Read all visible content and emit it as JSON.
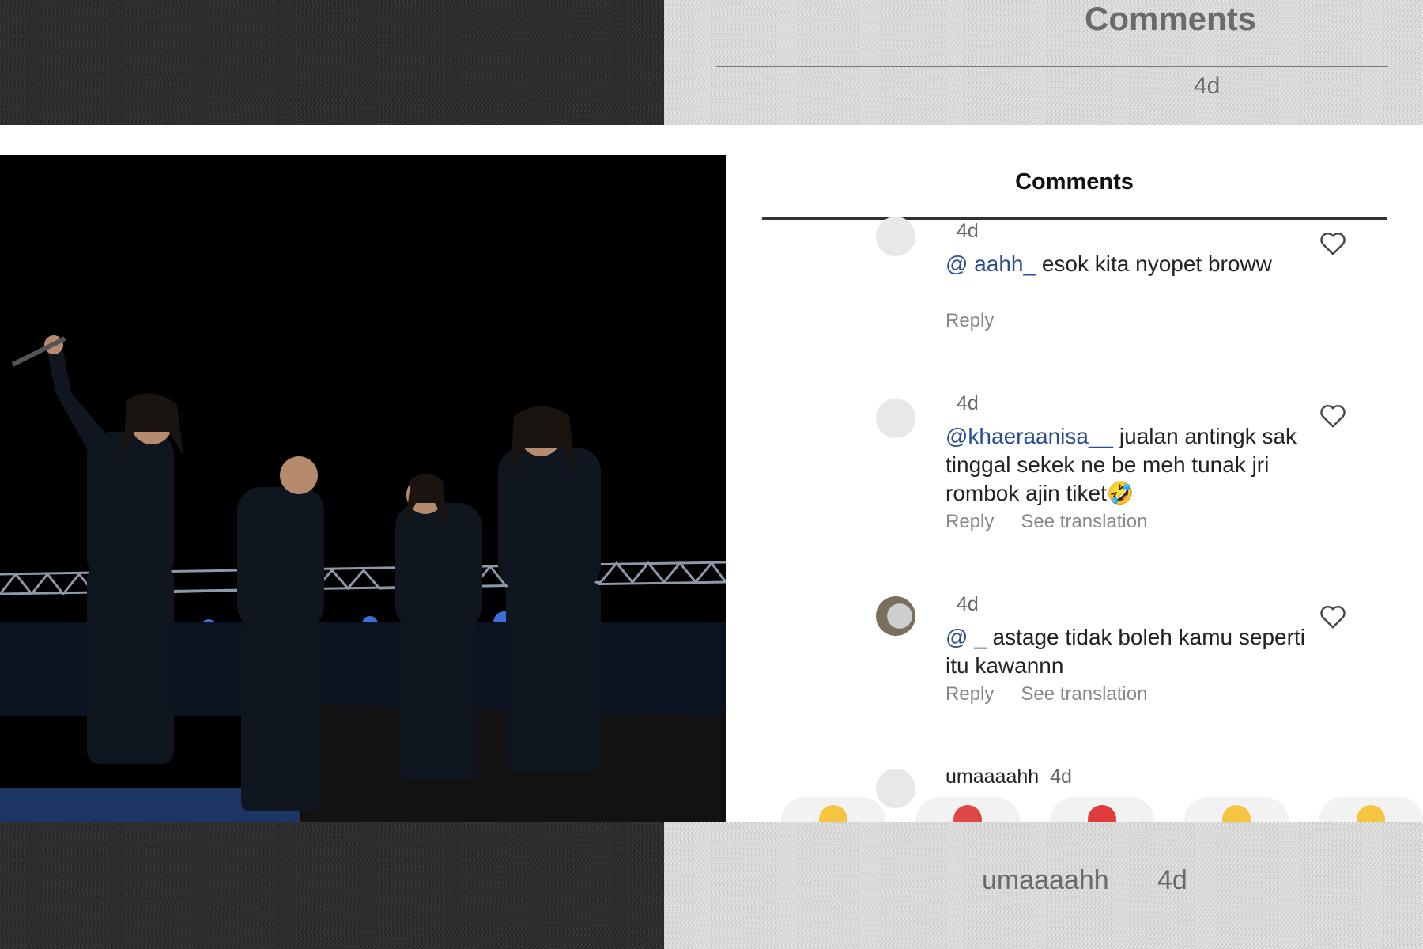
{
  "ghost_header": {
    "title": "Comments",
    "age": "4d"
  },
  "ghost_footer": {
    "username": "umaaaahh",
    "age": "4d"
  },
  "panel": {
    "title": "Comments"
  },
  "comments": [
    {
      "username": "",
      "age": "4d",
      "mention": "@         aahh_",
      "text": " esok kita nyopet broww",
      "reply": "Reply",
      "translate": ""
    },
    {
      "username": "",
      "age": "4d",
      "mention": "@khaeraanisa__",
      "text": " jualan antingk sak tinggal sekek ne be meh tunak jri rombok ajin tiket🤣",
      "reply": "Reply",
      "translate": "See translation"
    },
    {
      "username": "",
      "age": "4d",
      "mention": "@               _",
      "text": " astage tidak boleh kamu seperti itu kawannn",
      "reply": "Reply",
      "translate": "See translation"
    },
    {
      "username": "umaaaahh",
      "age": "4d",
      "mention": "",
      "text": "",
      "reply": "",
      "translate": ""
    }
  ],
  "icons": {
    "like": "heart-outline-icon"
  },
  "colors": {
    "mention": "#2a4e8e",
    "stage_light": "#3b6fd9"
  }
}
